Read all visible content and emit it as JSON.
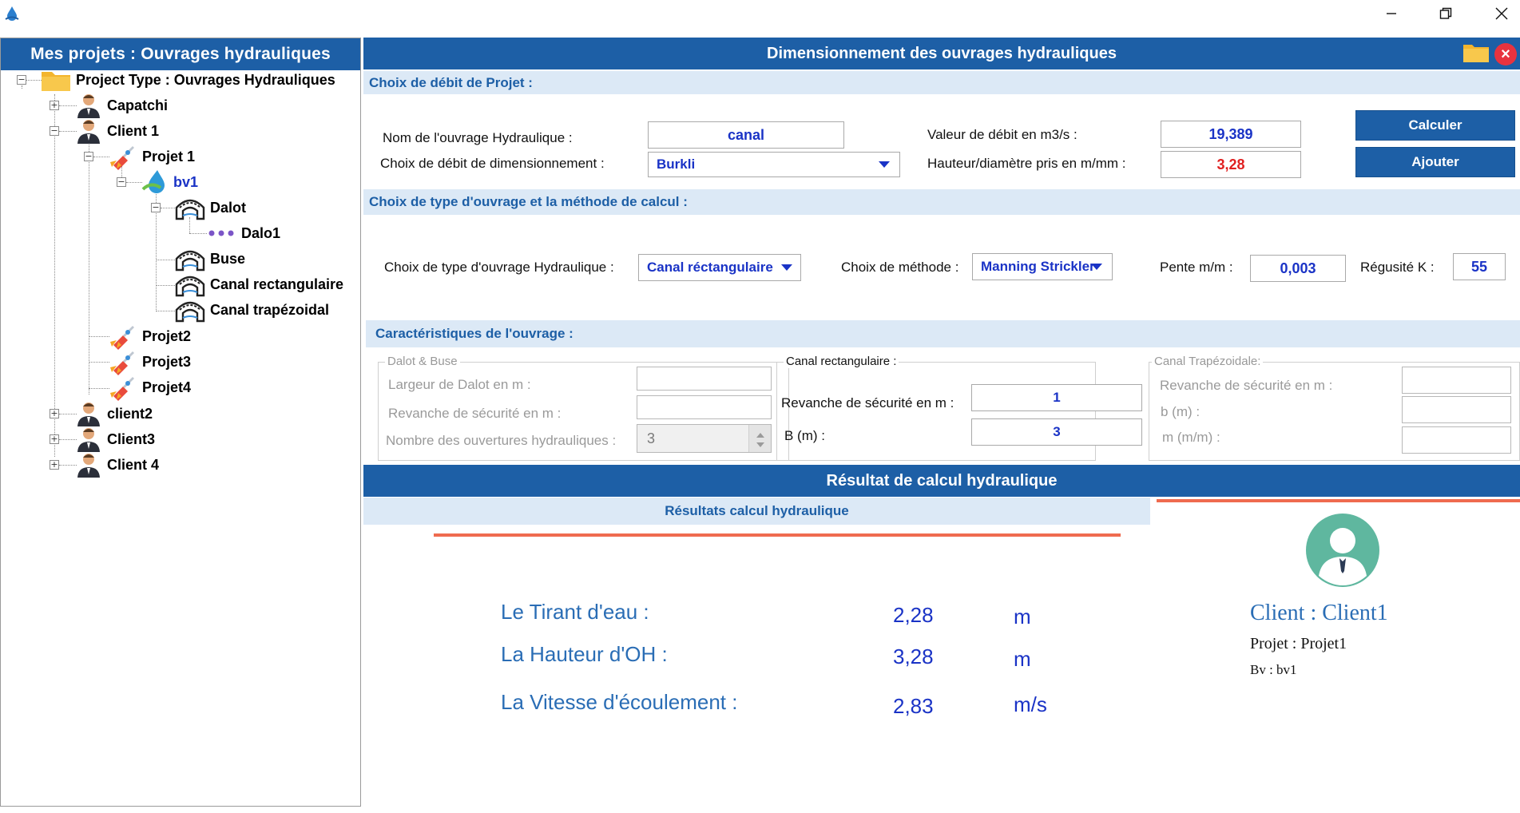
{
  "window": {
    "app_icon": "water-drop-icon",
    "controls": {
      "minimize": "minimize-icon",
      "restore": "restore-icon",
      "close": "close-icon"
    }
  },
  "left": {
    "header": "Mes projets : Ouvrages hydrauliques",
    "tree": {
      "root": "Project Type : Ouvrages Hydrauliques",
      "capatchi": "Capatchi",
      "client1": "Client 1",
      "projet1": "Projet 1",
      "bv1": "bv1",
      "dalot": "Dalot",
      "dalo1": "Dalo1",
      "buse": "Buse",
      "canal_rect": "Canal rectangulaire",
      "canal_trap": "Canal trapézoidal",
      "projet2": "Projet2",
      "projet3": "Projet3",
      "projet4": "Projet4",
      "client2": "client2",
      "client3": "Client3",
      "client4": "Client 4"
    }
  },
  "right": {
    "header": "Dimensionnement des ouvrages hydrauliques",
    "debit_section": {
      "title": "Choix de débit de Projet :",
      "nom_label": "Nom de l'ouvrage Hydraulique  :",
      "nom_value": "canal",
      "choix_label": "Choix de débit de dimensionnement :",
      "choix_value": "Burkli",
      "debit_label": "Valeur de débit en m3/s :",
      "debit_value": "19,389",
      "hauteur_label": "Hauteur/diamètre  pris  en m/mm :",
      "hauteur_value": "3,28",
      "calculer": "Calculer",
      "ajouter": "Ajouter"
    },
    "type_section": {
      "title": "Choix de type d'ouvrage et la méthode de calcul :",
      "type_label": "Choix de type d'ouvrage Hydraulique :",
      "type_value": "Canal réctangulaire",
      "methode_label": "Choix de méthode :",
      "methode_value": "Manning Strickler",
      "pente_label": "Pente m/m  :",
      "pente_value": "0,003",
      "regusite_label": "Régusité K  :",
      "regusite_value": "55"
    },
    "carac_section": {
      "title": "Caractéristiques de l'ouvrage :",
      "dalot": {
        "title": "Dalot & Buse",
        "largeur": "Largeur de Dalot en m :",
        "revanche": "Revanche de sécurité en m :",
        "nombre": "Nombre des ouvertures hydrauliques :",
        "nombre_value": "3"
      },
      "rect": {
        "title": "Canal rectangulaire :",
        "revanche": "Revanche de sécurité en m :",
        "revanche_value": "1",
        "b": "B (m) :",
        "b_value": "3"
      },
      "trap": {
        "title": "Canal Trapézoidale:",
        "revanche": "Revanche de sécurité en m :",
        "b": "b (m) :",
        "m": "m (m/m) :"
      }
    },
    "results": {
      "header": "Résultat de calcul hydraulique",
      "sub": "Résultats calcul hydraulique",
      "tirant_label": "Le Tirant d'eau  :",
      "tirant_value": "2,28",
      "tirant_unit": "m",
      "hauteur_label": "La Hauteur d'OH  :",
      "hauteur_value": "3,28",
      "hauteur_unit": "m",
      "vitesse_label": "La Vitesse d'écoulement  :",
      "vitesse_value": "2,83",
      "vitesse_unit": "m/s"
    },
    "client_card": {
      "avatar": "user-avatar-icon",
      "client": "Client :  Client1",
      "projet": "Projet :  Projet1",
      "bv": "Bv : bv1"
    }
  },
  "colors": {
    "header_blue": "#1d5fa6",
    "section_bg": "#dce9f6",
    "value_blue": "#1a33c6",
    "value_red": "#e02020",
    "accent_red": "#ef6b4f"
  }
}
